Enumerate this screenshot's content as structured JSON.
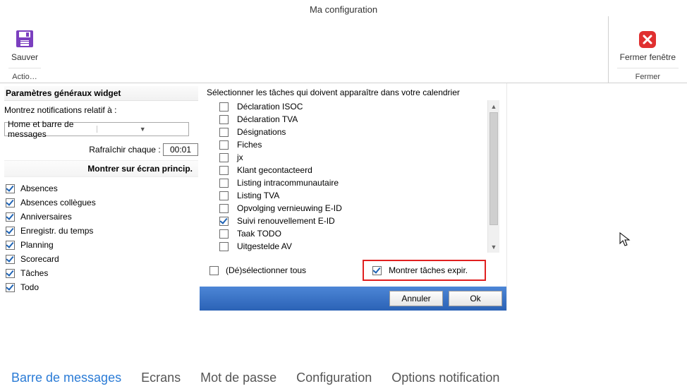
{
  "window": {
    "title": "Ma configuration"
  },
  "ribbon": {
    "save": {
      "label": "Sauver",
      "section": "Actio…"
    },
    "close": {
      "label": "Fermer fenêtre",
      "section": "Fermer"
    }
  },
  "left": {
    "header": "Paramètres généraux widget",
    "notif_label": "Montrez notifications relatif à :",
    "notif_value": "Home et barre de messages",
    "refresh_label": "Rafraîchir chaque :",
    "refresh_value": "00:01",
    "subheader": "Montrer sur écran princip.",
    "items": [
      {
        "label": "Absences",
        "checked": true
      },
      {
        "label": "Absences collègues",
        "checked": true
      },
      {
        "label": "Anniversaires",
        "checked": true
      },
      {
        "label": "Enregistr. du temps",
        "checked": true
      },
      {
        "label": "Planning",
        "checked": true
      },
      {
        "label": "Scorecard",
        "checked": true
      },
      {
        "label": "Tâches",
        "checked": true
      },
      {
        "label": "Todo",
        "checked": true
      }
    ]
  },
  "dialog": {
    "instruction": "Sélectionner les tâches qui doivent apparaître dans votre calendrier",
    "tasks": [
      {
        "label": "Déclaration ISOC",
        "checked": false
      },
      {
        "label": "Déclaration TVA",
        "checked": false
      },
      {
        "label": "Désignations",
        "checked": false
      },
      {
        "label": "Fiches",
        "checked": false
      },
      {
        "label": "jx",
        "checked": false
      },
      {
        "label": "Klant gecontacteerd",
        "checked": false
      },
      {
        "label": "Listing intracommunautaire",
        "checked": false
      },
      {
        "label": "Listing TVA",
        "checked": false
      },
      {
        "label": "Opvolging vernieuwing E-ID",
        "checked": false
      },
      {
        "label": "Suivi renouvellement E-ID",
        "checked": true
      },
      {
        "label": "Taak TODO",
        "checked": false
      },
      {
        "label": "Uitgestelde AV",
        "checked": false
      }
    ],
    "select_all": {
      "label": "(Dé)sélectionner tous",
      "checked": false
    },
    "show_expired": {
      "label": "Montrer tâches expir.",
      "checked": true
    },
    "cancel": "Annuler",
    "ok": "Ok"
  },
  "tabs": [
    {
      "label": "Barre de messages",
      "active": true
    },
    {
      "label": "Ecrans",
      "active": false
    },
    {
      "label": "Mot de passe",
      "active": false
    },
    {
      "label": "Configuration",
      "active": false
    },
    {
      "label": "Options notification",
      "active": false
    }
  ]
}
